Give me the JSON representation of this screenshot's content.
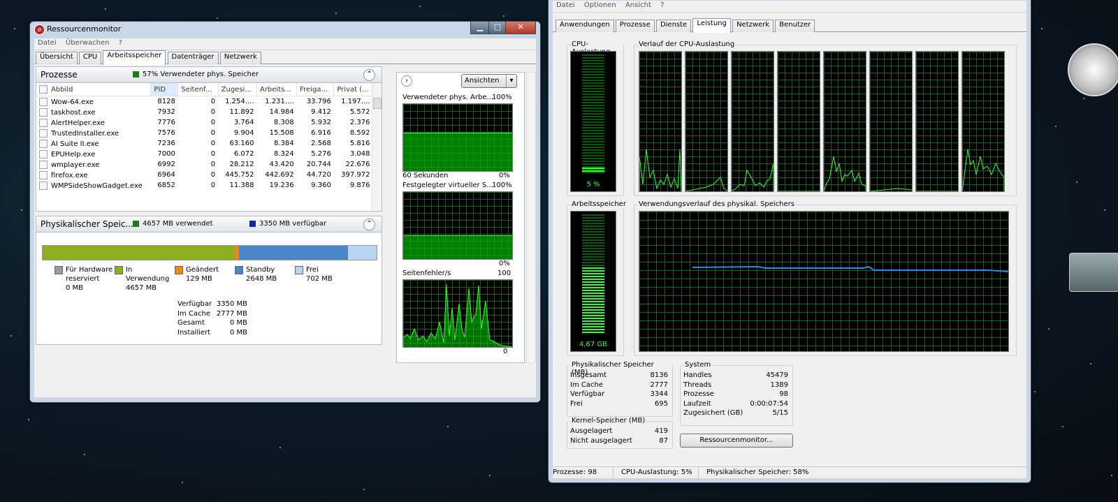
{
  "resmon": {
    "title": "Ressourcenmonitor",
    "menu": [
      "Datei",
      "Überwachen",
      "?"
    ],
    "tabs": [
      "Übersicht",
      "CPU",
      "Arbeitsspeicher",
      "Datenträger",
      "Netzwerk"
    ],
    "active_tab": 2,
    "processes": {
      "title": "Prozesse",
      "status": "57% Verwendeter phys. Speicher",
      "status_color": "#1f7a1f",
      "columns": [
        "Abbild",
        "PID",
        "Seitenf...",
        "Zugesi...",
        "Arbeits...",
        "Freiga...",
        "Privat (..."
      ],
      "rows": [
        [
          "Wow-64.exe",
          "8128",
          "0",
          "1.254....",
          "1.231....",
          "33.796",
          "1.197...."
        ],
        [
          "taskhost.exe",
          "7932",
          "0",
          "11.892",
          "14.984",
          "9.412",
          "5.572"
        ],
        [
          "AlertHelper.exe",
          "7776",
          "0",
          "3.764",
          "8.308",
          "5.932",
          "2.376"
        ],
        [
          "TrustedInstaller.exe",
          "7576",
          "0",
          "9.904",
          "15.508",
          "6.916",
          "8.592"
        ],
        [
          "AI Suite II.exe",
          "7236",
          "0",
          "63.160",
          "8.384",
          "2.568",
          "5.816"
        ],
        [
          "EPUHelp.exe",
          "7000",
          "0",
          "6.072",
          "8.324",
          "5.276",
          "3.048"
        ],
        [
          "wmplayer.exe",
          "6992",
          "0",
          "28.212",
          "43.420",
          "20.744",
          "22.676"
        ],
        [
          "firefox.exe",
          "6964",
          "0",
          "445.752",
          "442.692",
          "44.720",
          "397.972"
        ],
        [
          "WMPSideShowGadget.exe",
          "6852",
          "0",
          "11.388",
          "19.236",
          "9.360",
          "9.876"
        ]
      ]
    },
    "phys": {
      "title": "Physikalischer Speic...",
      "used_text": "4657 MB verwendet",
      "avail_text": "3350 MB verfügbar",
      "used_color": "#1f7a1f",
      "avail_color": "#1028a8",
      "bar": [
        {
          "name": "Für Hardware reserviert",
          "mb": 0,
          "color": "#9a9a9a"
        },
        {
          "name": "In Verwendung",
          "mb": 4657,
          "color": "#8cb021"
        },
        {
          "name": "Geändert",
          "mb": 129,
          "color": "#e88a1a"
        },
        {
          "name": "Standby",
          "mb": 2648,
          "color": "#4a86c8"
        },
        {
          "name": "Frei",
          "mb": 702,
          "color": "#b8d4f0"
        }
      ],
      "legend": [
        {
          "l1": "Für Hardware",
          "l2": "reserviert",
          "val": "0 MB"
        },
        {
          "l1": "In",
          "l2": "Verwendung",
          "val": "4657 MB"
        },
        {
          "l1": "Geändert",
          "l2": "",
          "val": "129 MB"
        },
        {
          "l1": "Standby",
          "l2": "",
          "val": "2648 MB"
        },
        {
          "l1": "Frei",
          "l2": "",
          "val": "702 MB"
        }
      ],
      "summary": [
        {
          "k": "Verfügbar",
          "v": "3350 MB"
        },
        {
          "k": "Im Cache",
          "v": "2777 MB"
        },
        {
          "k": "Gesamt",
          "v": "0 MB"
        },
        {
          "k": "Installiert",
          "v": "0 MB"
        }
      ]
    },
    "side": {
      "views_label": "Ansichten",
      "graph1_title": "Verwendeter phys. Arbe...",
      "graph1_max": "100%",
      "graph1_time": "60 Sekunden",
      "graph1_min": "0%",
      "graph2_title": "Festgelegter virtueller S...",
      "graph2_max": "100%",
      "graph2_min": "0%",
      "graph3_title": "Seitenfehler/s",
      "graph3_max": "100",
      "graph3_min": "0"
    }
  },
  "taskmgr": {
    "menu": [
      "Datei",
      "Optionen",
      "Ansicht",
      "?"
    ],
    "tabs": [
      "Anwendungen",
      "Prozesse",
      "Dienste",
      "Leistung",
      "Netzwerk",
      "Benutzer"
    ],
    "active_tab": 3,
    "cpu_usage_label": "CPU-Auslastung",
    "cpu_usage_value": "5 %",
    "cpu_history_label": "Verlauf der CPU-Auslastung",
    "mem_label": "Arbeitsspeicher",
    "mem_value": "4,67 GB",
    "mem_history_label": "Verwendungsverlauf des physikal. Speichers",
    "phys_group": {
      "title": "Physikalischer Speicher (MB)",
      "rows": [
        {
          "k": "Insgesamt",
          "v": "8136"
        },
        {
          "k": "Im Cache",
          "v": "2777"
        },
        {
          "k": "Verfügbar",
          "v": "3344"
        },
        {
          "k": "Frei",
          "v": "695"
        }
      ]
    },
    "kernel_group": {
      "title": "Kernel-Speicher (MB)",
      "rows": [
        {
          "k": "Ausgelagert",
          "v": "419"
        },
        {
          "k": "Nicht ausgelagert",
          "v": "87"
        }
      ]
    },
    "system_group": {
      "title": "System",
      "rows": [
        {
          "k": "Handles",
          "v": "45479"
        },
        {
          "k": "Threads",
          "v": "1389"
        },
        {
          "k": "Prozesse",
          "v": "98"
        },
        {
          "k": "Laufzeit",
          "v": "0:00:07:54"
        },
        {
          "k": "Zugesichert (GB)",
          "v": "5/15"
        }
      ]
    },
    "resmon_button": "Ressourcenmonitor...",
    "status": {
      "processes": "Prozesse: 98",
      "cpu": "CPU-Auslastung: 5%",
      "mem": "Physikalischer Speicher: 58%"
    }
  }
}
